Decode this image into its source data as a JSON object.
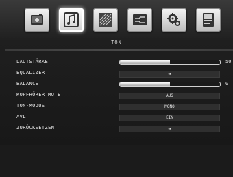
{
  "header": {
    "section_title": "TON",
    "icons": [
      {
        "name": "picture-icon",
        "active": false
      },
      {
        "name": "sound-icon",
        "active": true
      },
      {
        "name": "settings-dial-icon",
        "active": false
      },
      {
        "name": "connection-icon",
        "active": false
      },
      {
        "name": "gear-icon",
        "active": false
      },
      {
        "name": "info-icon",
        "active": false
      }
    ]
  },
  "menu": {
    "lautstaerke": {
      "label": "LAUTSTÄRKE",
      "level": 0.5,
      "value": "50"
    },
    "equalizer": {
      "label": "EQUALIZER",
      "value": "➔"
    },
    "balance": {
      "label": "BALANCE",
      "level": 0.5,
      "value": "0"
    },
    "kopfhoerer_mute": {
      "label": "KOPFHÖRER MUTE",
      "value": "AUS"
    },
    "ton_modus": {
      "label": "TON-MODUS",
      "value": "MONO"
    },
    "avl": {
      "label": "AVL",
      "value": "EIN"
    },
    "zuruecksetzen": {
      "label": "ZURÜCKSETZEN",
      "value": "➔"
    }
  },
  "colors": {
    "background": "#1f1f1f",
    "text": "#e6e6e6",
    "value_box": "#2f2f2f"
  }
}
